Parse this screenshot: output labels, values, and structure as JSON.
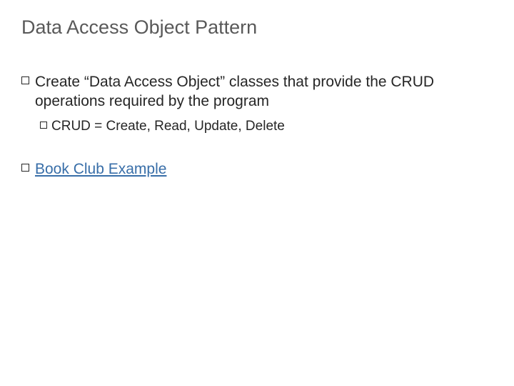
{
  "title": "Data Access Object Pattern",
  "bullets": {
    "b1": "Create “Data Access Object” classes that provide the CRUD operations required by the program",
    "b1a": "CRUD = Create, Read, Update, Delete",
    "b2": "Book Club Example"
  }
}
